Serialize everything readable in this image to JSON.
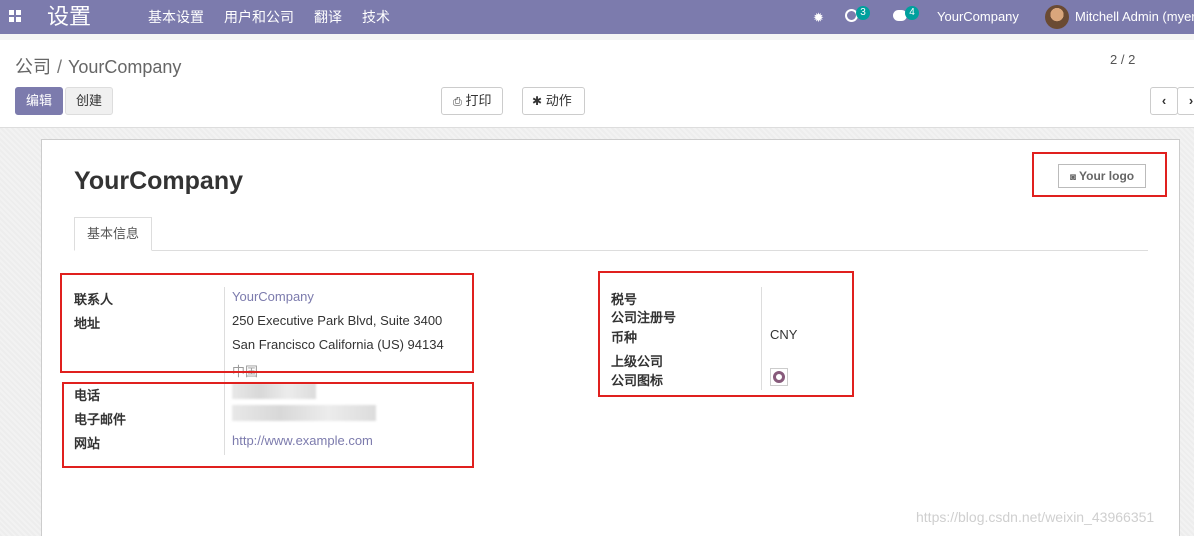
{
  "navbar": {
    "app_title": "设置",
    "menu": [
      "基本设置",
      "用户和公司",
      "翻译",
      "技术"
    ],
    "activity_count": "3",
    "message_count": "4",
    "company": "YourCompany",
    "user": "Mitchell Admin (myer"
  },
  "breadcrumb": {
    "parent": "公司",
    "separator": "/",
    "current": "YourCompany"
  },
  "buttons": {
    "edit": "编辑",
    "create": "创建",
    "print": "打印",
    "action": "动作"
  },
  "pager": {
    "value": "2 / 2"
  },
  "form": {
    "company_name": "YourCompany",
    "logo_label": "Your logo",
    "tab": "基本信息",
    "left": {
      "contact_label": "联系人",
      "contact_value": "YourCompany",
      "address_label": "地址",
      "address_line1": "250 Executive Park Blvd, Suite 3400",
      "address_line2": "San Francisco  California (US)  94134",
      "address_line3": "中国",
      "phone_label": "电话",
      "email_label": "电子邮件",
      "website_label": "网站",
      "website_value": "http://www.example.com"
    },
    "right": {
      "vat_label": "税号",
      "registry_label": "公司注册号",
      "currency_label": "币种",
      "currency_value": "CNY",
      "parent_label": "上级公司",
      "icon_label": "公司图标"
    }
  },
  "watermark": "https://blog.csdn.net/weixin_43966351",
  "colors": {
    "brand": "#7c7bad",
    "highlight": "#e0201e",
    "badge": "#00a09d"
  }
}
